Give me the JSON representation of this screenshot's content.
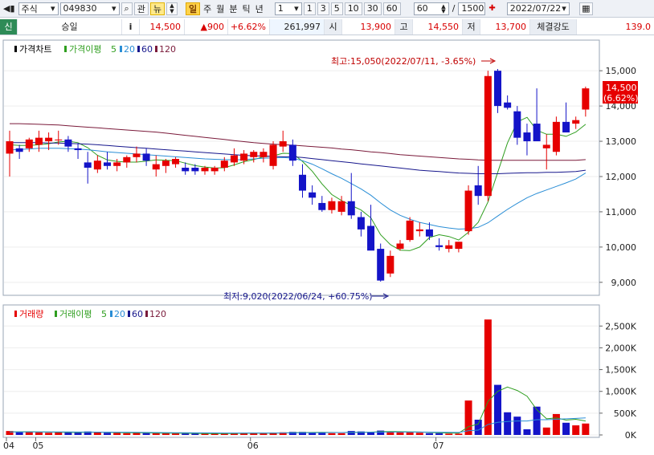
{
  "toolbar": {
    "market": "주식",
    "code": "049830",
    "btn_gwan": "관",
    "btn_new": "뉴",
    "period_tabs": [
      "일",
      "주",
      "월",
      "분",
      "틱",
      "년"
    ],
    "interval_value": "1",
    "quick_intervals": [
      "1",
      "3",
      "5",
      "10",
      "30",
      "60"
    ],
    "count_value": "60",
    "count_separator": "/",
    "max_count": "1500",
    "date_value": "2022/07/22"
  },
  "quote": {
    "badge": "신",
    "name": "승일",
    "info_icon": "i",
    "price": "14,500",
    "change": "▲900",
    "change_pct": "+6.62%",
    "volume": "261,997",
    "open_label": "시",
    "open": "13,900",
    "high_label": "고",
    "high": "14,550",
    "low_label": "저",
    "low": "13,700",
    "strength_label": "체결강도",
    "strength": "139.0"
  },
  "price_legend": {
    "price_chart": "가격차트",
    "ma_label": "가격이평",
    "ma_periods": [
      "5",
      "20",
      "60",
      "120"
    ]
  },
  "volume_legend": {
    "volume": "거래량",
    "ma_label": "거래이평",
    "ma_periods": [
      "5",
      "20",
      "60",
      "120"
    ]
  },
  "annotations": {
    "high": "최고:15,050(2022/07/11, -3.65%)",
    "low": "최저:9,020(2022/06/24, +60.75%)"
  },
  "last_price_box": [
    "14,500",
    "(6.62%)"
  ],
  "colors": {
    "up": "#e60000",
    "down": "#1414c8",
    "ma5": "#2f9e1f",
    "ma20": "#2a8ed6",
    "ma60": "#16168c",
    "ma120": "#7a1a3a"
  },
  "chart_data": [
    {
      "type": "candlestick",
      "title": "가격차트",
      "x_labels": [
        "04",
        "05",
        "06",
        "07"
      ],
      "y_ticks": [
        "15,000",
        "14,000",
        "13,000",
        "12,000",
        "11,000",
        "10,000",
        "9,000"
      ],
      "ylim": [
        8700,
        15800
      ],
      "ohlc": [
        [
          12650,
          13300,
          12000,
          13000
        ],
        [
          12800,
          12900,
          12500,
          12700
        ],
        [
          12800,
          13100,
          12700,
          13050
        ],
        [
          12900,
          13300,
          12700,
          13100
        ],
        [
          13000,
          13250,
          12750,
          13100
        ],
        [
          13050,
          13300,
          12900,
          13050
        ],
        [
          13050,
          13150,
          12700,
          12850
        ],
        [
          12800,
          12950,
          12500,
          12750
        ],
        [
          12400,
          12700,
          11800,
          12250
        ],
        [
          12200,
          12600,
          12100,
          12450
        ],
        [
          12400,
          12700,
          12200,
          12300
        ],
        [
          12300,
          12500,
          12150,
          12400
        ],
        [
          12400,
          12600,
          12250,
          12550
        ],
        [
          12550,
          12850,
          12400,
          12650
        ],
        [
          12650,
          12800,
          12300,
          12450
        ],
        [
          12200,
          12600,
          12000,
          12350
        ],
        [
          12300,
          12500,
          12100,
          12450
        ],
        [
          12350,
          12550,
          12250,
          12500
        ],
        [
          12250,
          12400,
          12050,
          12150
        ],
        [
          12250,
          12350,
          12050,
          12150
        ],
        [
          12150,
          12300,
          12050,
          12250
        ],
        [
          12150,
          12300,
          12050,
          12250
        ],
        [
          12250,
          12550,
          12150,
          12450
        ],
        [
          12400,
          12800,
          12300,
          12600
        ],
        [
          12450,
          12750,
          12350,
          12650
        ],
        [
          12550,
          12750,
          12400,
          12700
        ],
        [
          12550,
          12800,
          12400,
          12700
        ],
        [
          12300,
          13000,
          12200,
          12900
        ],
        [
          12850,
          13300,
          12700,
          13000
        ],
        [
          12900,
          13050,
          12300,
          12450
        ],
        [
          12050,
          12350,
          11400,
          11600
        ],
        [
          11550,
          11750,
          11200,
          11400
        ],
        [
          11250,
          11450,
          11000,
          11050
        ],
        [
          11050,
          11400,
          10950,
          11300
        ],
        [
          11000,
          11450,
          10900,
          11300
        ],
        [
          11300,
          12100,
          10800,
          10900
        ],
        [
          10850,
          11000,
          10300,
          10500
        ],
        [
          10600,
          11200,
          10100,
          9900
        ],
        [
          9950,
          10100,
          9020,
          9050
        ],
        [
          9250,
          9900,
          9150,
          9750
        ],
        [
          9950,
          10200,
          9900,
          10100
        ],
        [
          10200,
          10850,
          10150,
          10750
        ],
        [
          10450,
          10700,
          10300,
          10500
        ],
        [
          10500,
          10700,
          10200,
          10300
        ],
        [
          10050,
          10250,
          9900,
          10000
        ],
        [
          9950,
          10200,
          9850,
          10050
        ],
        [
          9950,
          10150,
          9850,
          10150
        ],
        [
          10450,
          11750,
          10350,
          11600
        ],
        [
          11750,
          12300,
          11200,
          11450
        ],
        [
          11450,
          15000,
          11300,
          14850
        ],
        [
          15000,
          15050,
          13800,
          14000
        ],
        [
          14100,
          14300,
          13900,
          13950
        ],
        [
          13850,
          14000,
          12900,
          13100
        ],
        [
          13250,
          13500,
          12600,
          13000
        ],
        [
          13500,
          14500,
          13150,
          13000
        ],
        [
          12800,
          13200,
          12200,
          12900
        ],
        [
          12700,
          13700,
          12600,
          13550
        ],
        [
          13550,
          14100,
          13300,
          13250
        ],
        [
          13500,
          13700,
          13350,
          13600
        ],
        [
          13900,
          14550,
          13700,
          14500
        ]
      ],
      "series": [
        {
          "name": "5",
          "values": [
            12900,
            12880,
            12880,
            12900,
            12930,
            12980,
            13000,
            12960,
            12820,
            12600,
            12470,
            12430,
            12410,
            12410,
            12440,
            12470,
            12460,
            12450,
            12380,
            12310,
            12270,
            12240,
            12250,
            12330,
            12420,
            12480,
            12560,
            12590,
            12660,
            12650,
            12430,
            12150,
            11790,
            11490,
            11320,
            11180,
            11050,
            10830,
            10350,
            10070,
            9910,
            9900,
            10000,
            10270,
            10350,
            10300,
            10200,
            10420,
            10700,
            11280,
            12120,
            12950,
            13550,
            13680,
            13310,
            13200,
            13200,
            13140,
            13260,
            13480
          ]
        },
        {
          "name": "20",
          "values": [
            12750,
            12770,
            12780,
            12800,
            12800,
            12800,
            12790,
            12780,
            12760,
            12730,
            12700,
            12680,
            12660,
            12640,
            12620,
            12600,
            12580,
            12560,
            12540,
            12520,
            12500,
            12490,
            12480,
            12470,
            12480,
            12500,
            12520,
            12530,
            12540,
            12520,
            12450,
            12350,
            12220,
            12080,
            11950,
            11800,
            11650,
            11470,
            11250,
            11050,
            10900,
            10790,
            10700,
            10640,
            10580,
            10540,
            10510,
            10520,
            10560,
            10690,
            10880,
            11070,
            11240,
            11400,
            11520,
            11620,
            11720,
            11820,
            11930,
            12100
          ]
        },
        {
          "name": "60",
          "values": [
            12960,
            12960,
            12960,
            12960,
            12950,
            12950,
            12940,
            12930,
            12920,
            12900,
            12880,
            12860,
            12840,
            12820,
            12800,
            12780,
            12760,
            12740,
            12720,
            12700,
            12680,
            12660,
            12640,
            12620,
            12600,
            12590,
            12580,
            12570,
            12560,
            12560,
            12540,
            12510,
            12480,
            12450,
            12420,
            12390,
            12360,
            12330,
            12300,
            12270,
            12240,
            12210,
            12180,
            12160,
            12140,
            12120,
            12100,
            12090,
            12080,
            12080,
            12080,
            12090,
            12100,
            12110,
            12110,
            12120,
            12120,
            12130,
            12140,
            12180
          ]
        },
        {
          "name": "120",
          "values": [
            13500,
            13500,
            13490,
            13480,
            13470,
            13460,
            13440,
            13420,
            13400,
            13380,
            13360,
            13340,
            13320,
            13300,
            13280,
            13260,
            13230,
            13200,
            13170,
            13140,
            13110,
            13080,
            13050,
            13020,
            12990,
            12960,
            12940,
            12920,
            12900,
            12890,
            12870,
            12850,
            12830,
            12810,
            12780,
            12760,
            12730,
            12700,
            12680,
            12650,
            12620,
            12600,
            12580,
            12560,
            12540,
            12520,
            12500,
            12490,
            12470,
            12460,
            12460,
            12460,
            12460,
            12460,
            12460,
            12460,
            12460,
            12460,
            12460,
            12480
          ]
        }
      ]
    },
    {
      "type": "bar",
      "title": "거래량",
      "y_ticks": [
        "2,500K",
        "2,000K",
        "1,500K",
        "1,000K",
        "500K",
        "0K"
      ],
      "ylim": [
        0,
        2800
      ],
      "values": [
        90,
        70,
        80,
        60,
        50,
        70,
        60,
        55,
        80,
        60,
        50,
        45,
        40,
        55,
        45,
        40,
        40,
        35,
        35,
        30,
        30,
        30,
        40,
        45,
        40,
        40,
        35,
        55,
        60,
        70,
        70,
        60,
        55,
        40,
        40,
        90,
        80,
        70,
        100,
        70,
        60,
        60,
        50,
        40,
        40,
        30,
        30,
        790,
        350,
        2650,
        1150,
        520,
        420,
        130,
        650,
        170,
        480,
        280,
        220,
        262
      ],
      "series": [
        {
          "name": "5",
          "values": [
            70,
            72,
            74,
            70,
            66,
            62,
            60,
            58,
            62,
            64,
            60,
            56,
            52,
            50,
            48,
            45,
            43,
            41,
            38,
            36,
            33,
            32,
            33,
            35,
            38,
            40,
            41,
            43,
            46,
            50,
            56,
            58,
            60,
            58,
            56,
            60,
            62,
            64,
            74,
            80,
            76,
            72,
            66,
            58,
            50,
            44,
            40,
            190,
            250,
            770,
            1000,
            1100,
            1020,
            890,
            580,
            370,
            390,
            340,
            360,
            320
          ]
        },
        {
          "name": "20",
          "values": [
            70,
            70,
            70,
            70,
            70,
            69,
            68,
            67,
            66,
            65,
            64,
            63,
            62,
            60,
            58,
            56,
            54,
            52,
            50,
            48,
            47,
            46,
            45,
            44,
            44,
            44,
            44,
            45,
            46,
            48,
            50,
            52,
            54,
            55,
            56,
            58,
            60,
            62,
            64,
            66,
            66,
            66,
            66,
            64,
            62,
            60,
            58,
            95,
            110,
            240,
            290,
            310,
            320,
            320,
            350,
            350,
            360,
            370,
            380,
            390
          ]
        }
      ]
    }
  ]
}
